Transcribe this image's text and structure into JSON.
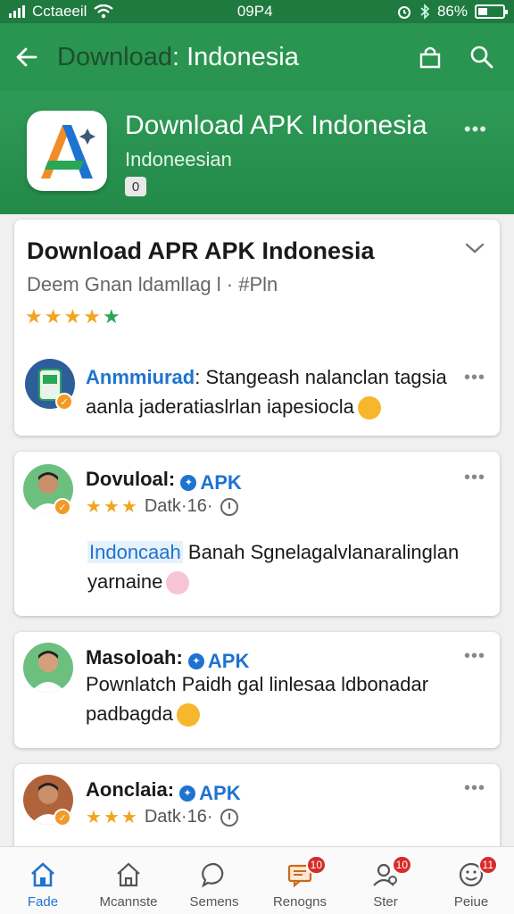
{
  "status_bar": {
    "carrier": "Cctaeeil",
    "time": "09P4",
    "battery": "86%"
  },
  "app_bar": {
    "title_dim": "Download",
    "title_main": ": Indonesia",
    "icons": [
      "back-arrow-icon",
      "bag-icon",
      "search-icon"
    ]
  },
  "app_header": {
    "name": "Download APK Indonesia",
    "subtitle": "Indoneesian",
    "badge": "0",
    "more": "•••"
  },
  "main_card": {
    "title": "Download APR APK Indonesia",
    "meta": "Deem Gnan ldamllag l · #Pln",
    "rating": {
      "filled": 4,
      "total": 5
    },
    "announcement": {
      "author": "Anmmiurad",
      "line1": ": Stangeash nalanclan tagsia",
      "line2": "aanla jaderatiaslrlan iapesiocla",
      "more": "•••"
    }
  },
  "posts": [
    {
      "name": "Dovuloal:",
      "tag": "APK",
      "stars": 3,
      "meta": "Datk·16·",
      "body_highlight": "Indoncaah",
      "body_line1": "Banah Sgnelagalvlanaralinglan",
      "body_line2": "yarnaine",
      "more": "•••"
    },
    {
      "name": "Masoloah:",
      "tag": "APK",
      "body_line1": "Pownlatch Paidh gal linlesaa ldbonadar",
      "body_line2": "padbagda",
      "more": "•••"
    },
    {
      "name": "Aonclaia:",
      "tag": "APK",
      "stars": 3,
      "meta": "Datk·16·",
      "more": "•••"
    }
  ],
  "bottom_nav": [
    {
      "label": "Fade",
      "icon": "home-icon",
      "active": true
    },
    {
      "label": "Mcannste",
      "icon": "house-outline-icon",
      "active": false
    },
    {
      "label": "Semens",
      "icon": "chat-bubble-icon",
      "active": false
    },
    {
      "label": "Renogns",
      "icon": "message-box-icon",
      "active": false,
      "badge": "10"
    },
    {
      "label": "Ster",
      "icon": "user-search-icon",
      "active": false,
      "badge": "10"
    },
    {
      "label": "Peiue",
      "icon": "emoji-icon",
      "active": false,
      "badge": "11"
    }
  ],
  "colors": {
    "primary_green": "#2a9550",
    "status_green": "#1f7a3f",
    "link_blue": "#1e73d0",
    "star": "#f0a620",
    "badge_red": "#d82b2b"
  }
}
